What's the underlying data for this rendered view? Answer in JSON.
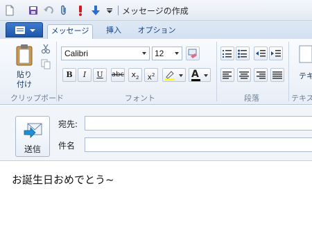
{
  "window": {
    "title": "メッセージの作成"
  },
  "tabs": [
    {
      "label": "メッセージ",
      "active": true
    },
    {
      "label": "挿入",
      "active": false
    },
    {
      "label": "オプション",
      "active": false
    }
  ],
  "clipboard": {
    "paste_label": "貼り付け",
    "group_label": "クリップボード"
  },
  "font": {
    "family": "Calibri",
    "size": "12",
    "group_label": "フォント",
    "highlight_color": "#ffff00",
    "text_color": "#000000"
  },
  "paragraph": {
    "group_label": "段落"
  },
  "text": {
    "label": "テキ",
    "group_label": "テキス"
  },
  "header": {
    "send_label": "送信",
    "to_label": "宛先:",
    "to_value": "",
    "subject_label": "件名",
    "subject_value": ""
  },
  "message": {
    "body": "お誕生日おめでとう~"
  },
  "colors": {
    "accent": "#1e56a8",
    "ribbon": "#e8eef7"
  }
}
